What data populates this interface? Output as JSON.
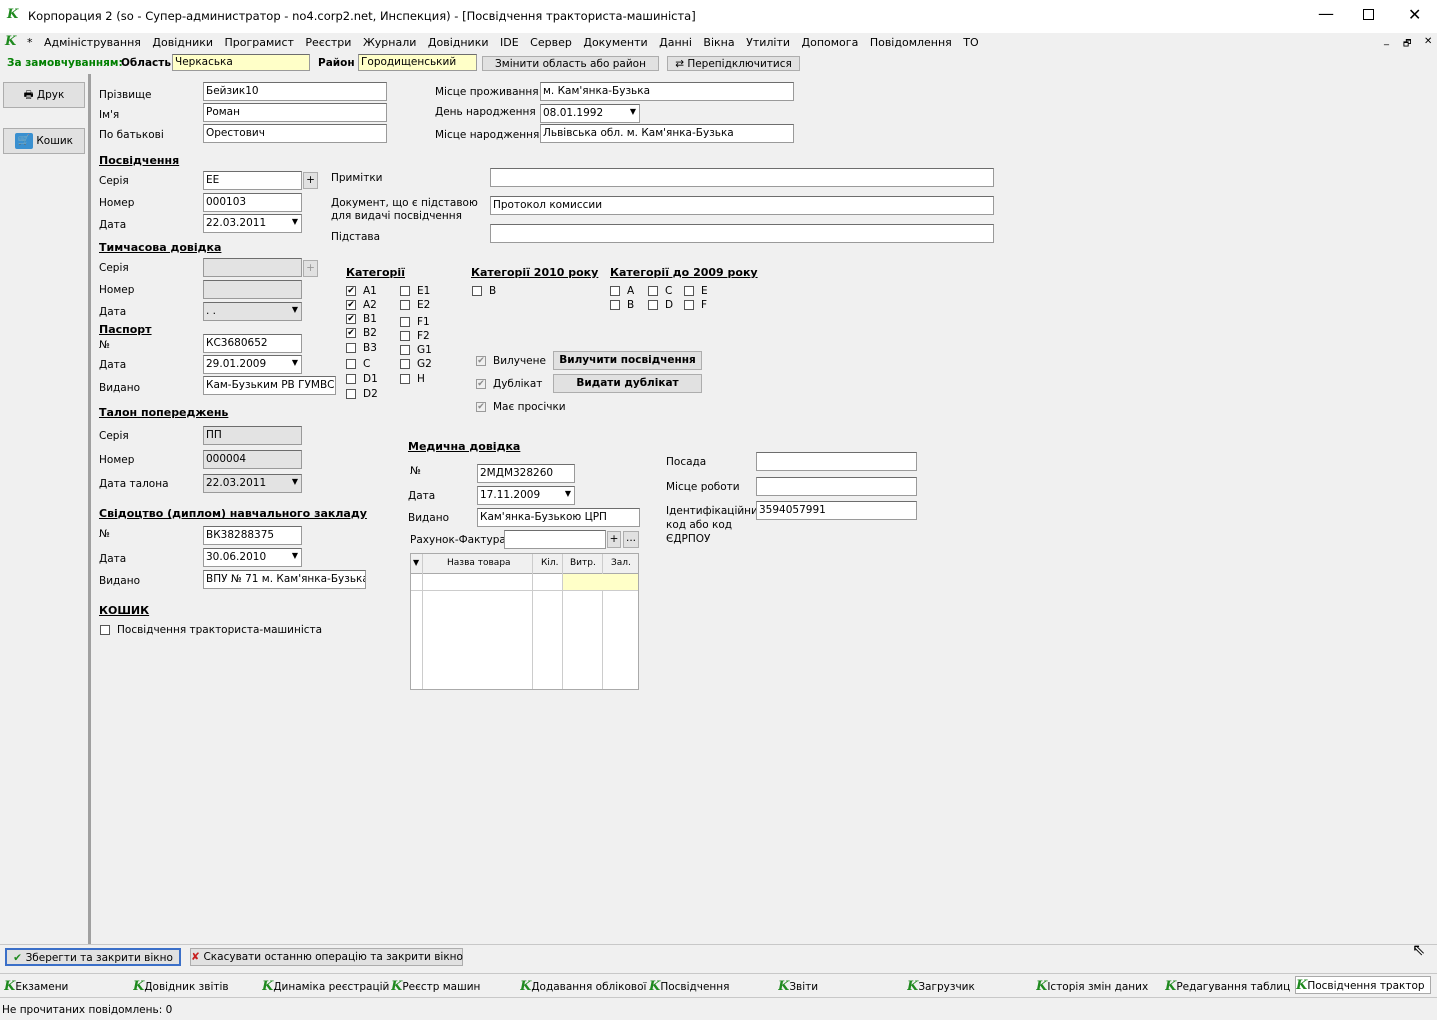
{
  "window": {
    "title": "Корпорация 2 (so - Супер-администратор - no4.corp2.net, Инспекция) - [Посвідчення тракториста-машиніста]",
    "icon": "app-k-logo-icon"
  },
  "menu": [
    "*",
    "Адміністрування",
    "Довідники",
    "Програмист",
    "Реєстри",
    "Журнали",
    "Довідники",
    "IDE",
    "Сервер",
    "Документи",
    "Данні",
    "Вікна",
    "Утиліти",
    "Допомога",
    "Повідомлення",
    "ТО"
  ],
  "filter": {
    "label": "За замовчуванням:",
    "region_label": "Область",
    "region_value": "Черкаська",
    "district_label": "Район",
    "district_value": "Городищенський",
    "change_btn": "Змінити область або район",
    "reconnect_btn": "Перепідключитися"
  },
  "side": {
    "print": "Друк",
    "cart": "Кошик"
  },
  "person": {
    "surname_label": "Прізвище",
    "surname": "Бейзик10",
    "name_label": "Ім'я",
    "name": "Роман",
    "patronymic_label": "По батькові",
    "patronymic": "Орестович",
    "residence_label": "Місце проживання",
    "residence": "м. Кам'янка-Бузька",
    "birthday_label": "День народження",
    "birthday": "08.01.1992",
    "birthplace_label": "Місце народження",
    "birthplace": "Львівська обл. м. Кам'янка-Бузька"
  },
  "cert": {
    "header": "Посвідчення",
    "series_label": "Серія",
    "series": "ЕЕ",
    "number_label": "Номер",
    "number": "000103",
    "date_label": "Дата",
    "date": "22.03.2011",
    "notes_label": "Примітки",
    "notes": "",
    "doc_label1": "Документ, що є підставою",
    "doc_label2": "для видачі посвідчення",
    "doc": "Протокол комиссии",
    "basis_label": "Підстава",
    "basis": ""
  },
  "temp": {
    "header": "Тимчасова довідка",
    "series_label": "Серія",
    "number_label": "Номер",
    "date_label": "Дата",
    "date": " .  ."
  },
  "passport": {
    "header": "Паспорт",
    "no_label": "№",
    "no": "КС3680652",
    "date_label": "Дата",
    "date": "29.01.2009",
    "issued_label": "Видано",
    "issued": "Кам-Бузьким  РВ ГУМВС"
  },
  "talon": {
    "header": "Талон попереджень",
    "series_label": "Серія",
    "series": "ПП",
    "number_label": "Номер",
    "number": "000004",
    "date_label": "Дата талона",
    "date": "22.03.2011"
  },
  "diploma": {
    "header": "Свідоцтво (диплом) навчального закладу",
    "no_label": "№",
    "no": "ВК38288375",
    "date_label": "Дата",
    "date": "30.06.2010",
    "issued_label": "Видано",
    "issued": "ВПУ № 71 м. Кам'янка-Бузька"
  },
  "cart_section": {
    "header": "КОШИК",
    "item": "Посвідчення тракториста-машиніста"
  },
  "categories": {
    "header": "Категорії",
    "col1": [
      {
        "l": "A1",
        "c": true
      },
      {
        "l": "A2",
        "c": true
      },
      {
        "l": "B1",
        "c": true
      },
      {
        "l": "B2",
        "c": true
      },
      {
        "l": "B3",
        "c": false
      },
      {
        "l": "C",
        "c": false
      },
      {
        "l": "D1",
        "c": false
      },
      {
        "l": "D2",
        "c": false
      }
    ],
    "col2": [
      {
        "l": "E1",
        "c": false
      },
      {
        "l": "E2",
        "c": false
      },
      {
        "l": "F1",
        "c": false
      },
      {
        "l": "F2",
        "c": false
      },
      {
        "l": "G1",
        "c": false
      },
      {
        "l": "G2",
        "c": false
      },
      {
        "l": "H",
        "c": false
      }
    ]
  },
  "cat2010": {
    "header": "Категорії 2010 року",
    "items": [
      "B"
    ]
  },
  "cat2009": {
    "header": "Категорії до 2009 року",
    "items": [
      "A",
      "C",
      "E",
      "B",
      "D",
      "F"
    ]
  },
  "flags": {
    "seized": "Вилучене",
    "duplicate": "Дублікат",
    "overdue": "Має просічки",
    "seize_btn": "Вилучити посвідчення",
    "dup_btn": "Видати дублікат"
  },
  "medical": {
    "header": "Медична довідка",
    "no_label": "№",
    "no": "2МДМ328260",
    "date_label": "Дата",
    "date": "17.11.2009",
    "issued_label": "Видано",
    "issued": "Кам'янка-Бузькою ЦРП",
    "invoice_label": "Рахунок-Фактура",
    "invoice": "",
    "plus": "+",
    "dots": "...",
    "columns": [
      "Назва товара",
      "Кіл.",
      "Витр.",
      "Зал."
    ]
  },
  "work": {
    "position_label": "Посада",
    "position": "",
    "workplace_label": "Місце роботи",
    "workplace": "",
    "id_label1": "Ідентифікаційний",
    "id_label2": "код або код",
    "id_label3": "ЄДРПОУ",
    "id": "3594057991"
  },
  "bottom": {
    "save": "Зберегти та закрити вікно",
    "cancel": "Скасувати останню операцію та закрити вікно"
  },
  "taskbar": [
    "Екзамени",
    "Довідник звітів",
    "Динаміка реєстрацій т",
    "Реєстр машин",
    "Додавання облікової",
    "Посвідчення",
    "Звіти",
    "Загрузчик",
    "Історія змін даних",
    "Редагування таблиц",
    "Посвідчення трактор"
  ],
  "status": "Не прочитаних повідомлень: 0",
  "colors": {
    "accent": "#1f8a1f",
    "filter_label": "#008000",
    "input_yellow": "#ffffc8"
  }
}
